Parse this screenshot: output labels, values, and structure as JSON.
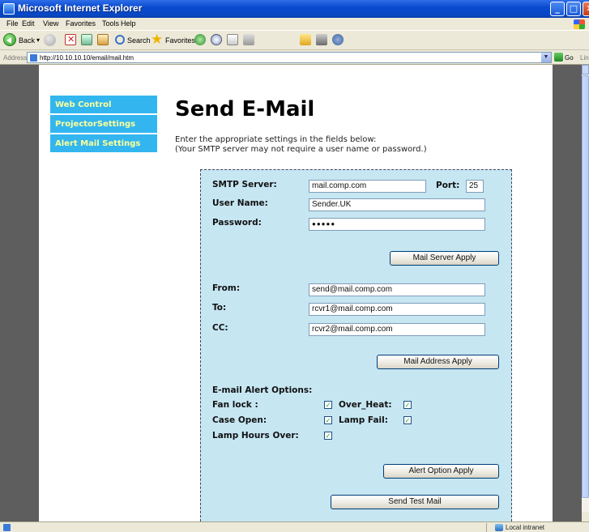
{
  "window": {
    "title": "Microsoft Internet Explorer"
  },
  "menu": {
    "file": "File",
    "edit": "Edit",
    "view": "View",
    "favorites": "Favorites",
    "tools": "Tools",
    "help": "Help"
  },
  "toolbar": {
    "back_label": "Back",
    "search_label": "Search",
    "favorites_label": "Favorites"
  },
  "address": {
    "label": "Address",
    "url": "http://10.10.10.10/email/mail.htm",
    "go_label": "Go",
    "links_label": "Links"
  },
  "nav": {
    "items": [
      {
        "label": "Web Control"
      },
      {
        "label": "ProjectorSettings"
      },
      {
        "label": "Alert Mail Settings"
      }
    ]
  },
  "page": {
    "title": "Send E-Mail",
    "intro_line1": "Enter the appropriate settings in the fields below:",
    "intro_line2": "(Your SMTP server may not require a user name or password.)"
  },
  "server": {
    "smtp_label": "SMTP Server:",
    "smtp_value": "mail.comp.com",
    "port_label": "Port:",
    "port_value": "25",
    "user_label": "User Name:",
    "user_value": "Sender.UK",
    "password_label": "Password:",
    "password_value": "●●●●●",
    "apply_label": "Mail Server Apply"
  },
  "address_fields": {
    "from_label": "From:",
    "from_value": "send@mail.comp.com",
    "to_label": "To:",
    "to_value": "rcvr1@mail.comp.com",
    "cc_label": "CC:",
    "cc_value": "rcvr2@mail.comp.com",
    "apply_label": "Mail Address Apply"
  },
  "alerts": {
    "heading": "E-mail Alert Options:",
    "fan_lock": {
      "label": "Fan lock :",
      "checked": true
    },
    "over_heat": {
      "label": "Over_Heat:",
      "checked": true
    },
    "case_open": {
      "label": "Case Open:",
      "checked": true
    },
    "lamp_fail": {
      "label": "Lamp Fail:",
      "checked": true
    },
    "lamp_hours": {
      "label": "Lamp Hours Over:",
      "checked": true
    },
    "check_mark": "✓",
    "apply_label": "Alert Option Apply",
    "send_test_label": "Send Test Mail"
  },
  "status": {
    "zone": "Local intranet"
  },
  "colors": {
    "panel": "#c6e6f2",
    "nav": "#33b6f0",
    "nav_text": "#ffff99",
    "frame": "#5e5e5e"
  }
}
